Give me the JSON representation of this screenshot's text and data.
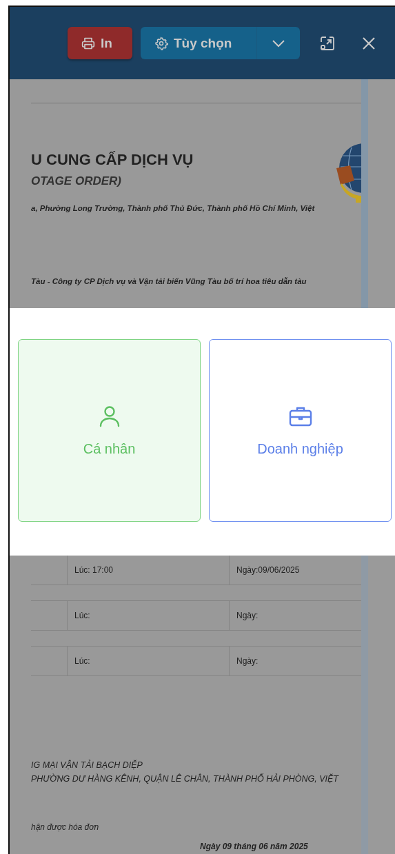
{
  "toolbar": {
    "print_button": "In",
    "options_button": "Tùy chọn"
  },
  "document": {
    "title": "U CUNG CẤP DỊCH VỤ",
    "subtitle": "OTAGE ORDER)",
    "address": "a, Phường Long Trường, Thành phố Thủ Đức, Thành phố Hồ Chí Minh, Việt",
    "notice": "Tàu - Công ty CP Dịch vụ và Vận tải biển Vũng Tàu bố trí hoa tiêu dẫn tàu",
    "schedule_rows": [
      {
        "time": "Lúc: 17:00",
        "date": "Ngày:09/06/2025"
      },
      {
        "time": "Lúc:",
        "date": "Ngày:"
      },
      {
        "time": "Lúc:",
        "date": "Ngày:"
      }
    ],
    "company": "IG MẠI VẬN TẢI BẠCH DIỆP",
    "company_address": "PHƯỜNG DƯ HÀNG KÊNH, QUẬN LÊ CHÂN, THÀNH PHỐ HẢI PHÒNG, VIỆT",
    "invoice_note": "hận được hóa đơn",
    "date_line": "Ngày 09 tháng 06 năm 2025"
  },
  "customer_type_dialog": {
    "options": [
      {
        "kind": "person",
        "label": "Cá nhân",
        "selected": true
      },
      {
        "kind": "business",
        "label": "Doanh nghiệp",
        "selected": false
      }
    ]
  }
}
